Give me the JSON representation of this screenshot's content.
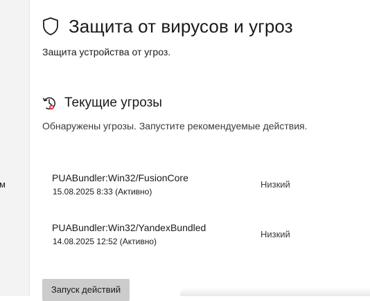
{
  "sidebar": {
    "fragment_text": "м"
  },
  "header": {
    "icon": "shield-icon",
    "title": "Защита от вирусов и угроз",
    "subtitle": "Защита устройства от угроз."
  },
  "current_threats": {
    "icon": "threat-clock-icon",
    "title": "Текущие угрозы",
    "description": "Обнаружены угрозы. Запустите рекомендуемые действия.",
    "items": [
      {
        "name": "PUABundler:Win32/FusionCore",
        "meta": "15.08.2025 8:33 (Активно)",
        "level": "Низкий"
      },
      {
        "name": "PUABundler:Win32/YandexBundled",
        "meta": "14.08.2025 12:52 (Активно)",
        "level": "Низкий"
      }
    ],
    "action_label": "Запуск действий"
  },
  "colors": {
    "alert_red": "#e81123",
    "text": "#1a1a1a",
    "button_bg": "#cccccc"
  }
}
